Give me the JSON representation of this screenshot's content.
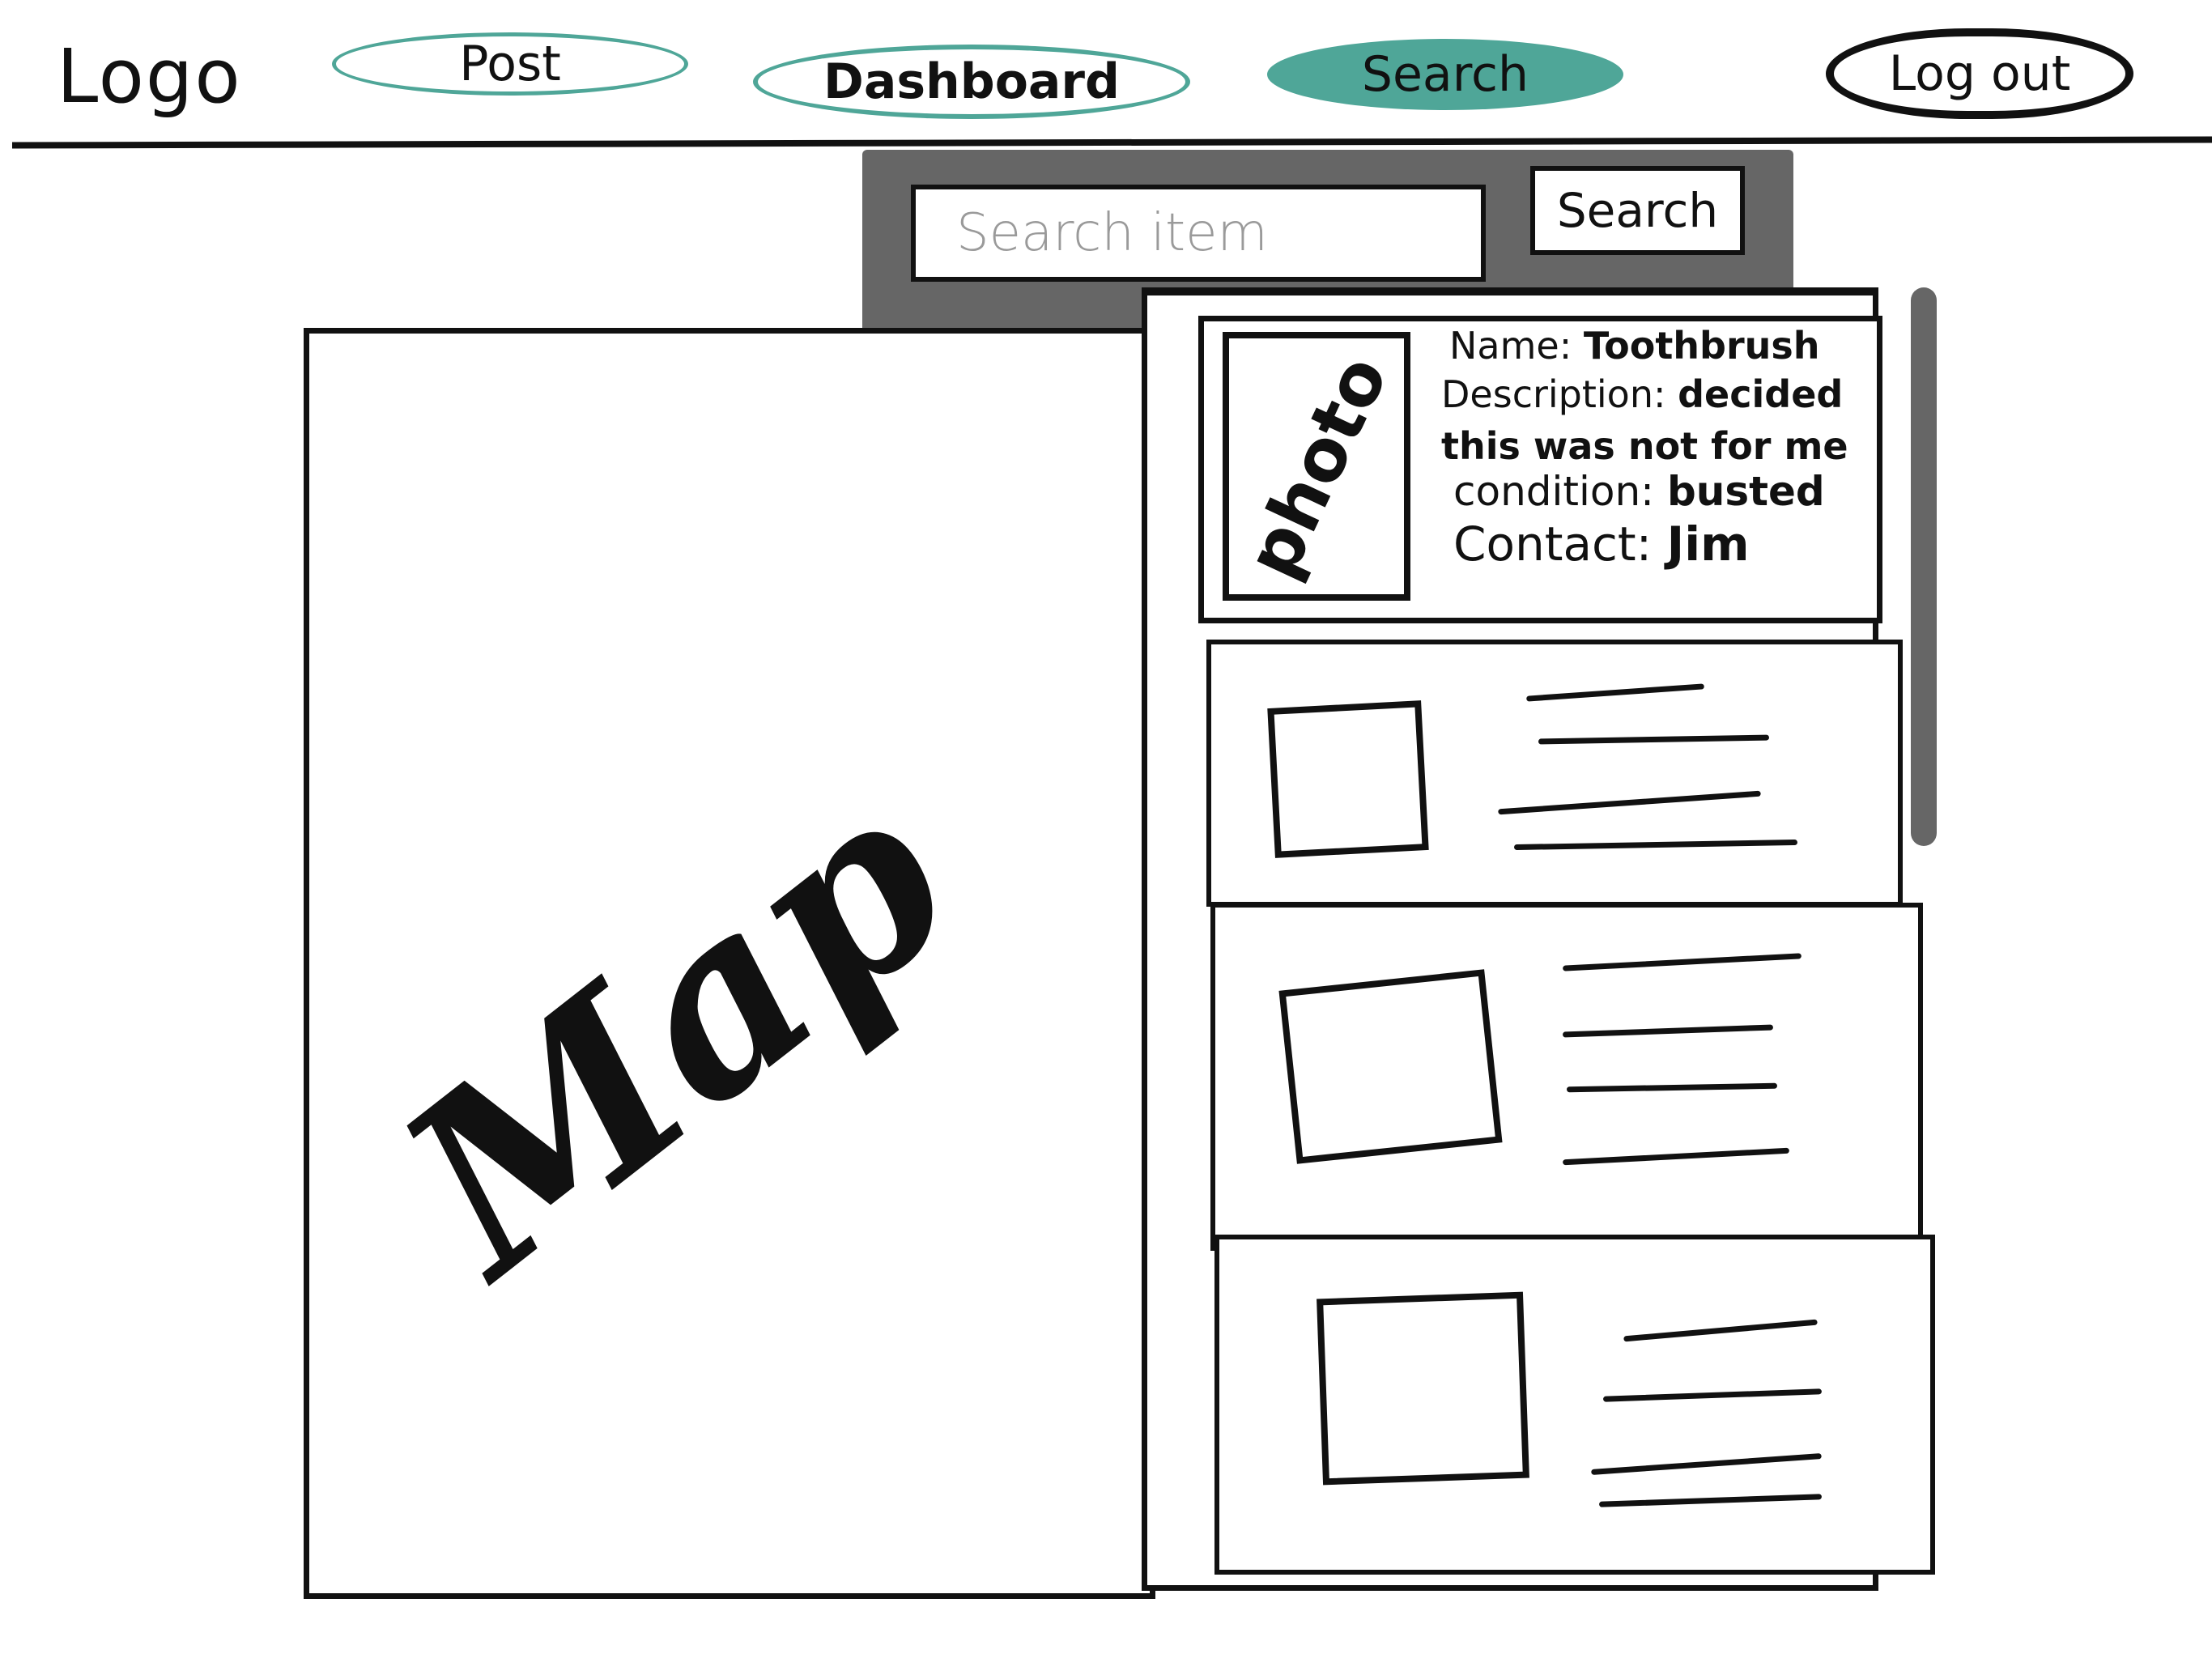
{
  "nav": {
    "logo": "Logo",
    "post": "Post",
    "dashboard": "Dashboard",
    "search": "Search",
    "logout": "Log out",
    "active_color": "#4fa698"
  },
  "search": {
    "placeholder": "Search item",
    "button": "Search",
    "panel_color": "#666666"
  },
  "map": {
    "label": "Map"
  },
  "results": {
    "featured": {
      "photo_label": "photo",
      "name_label": "Name:",
      "name": "Toothbrush",
      "description_label": "Description:",
      "description": "decided this was not for me",
      "condition_label": "condition:",
      "condition": "busted",
      "contact_label": "Contact:",
      "contact": "Jim"
    }
  }
}
